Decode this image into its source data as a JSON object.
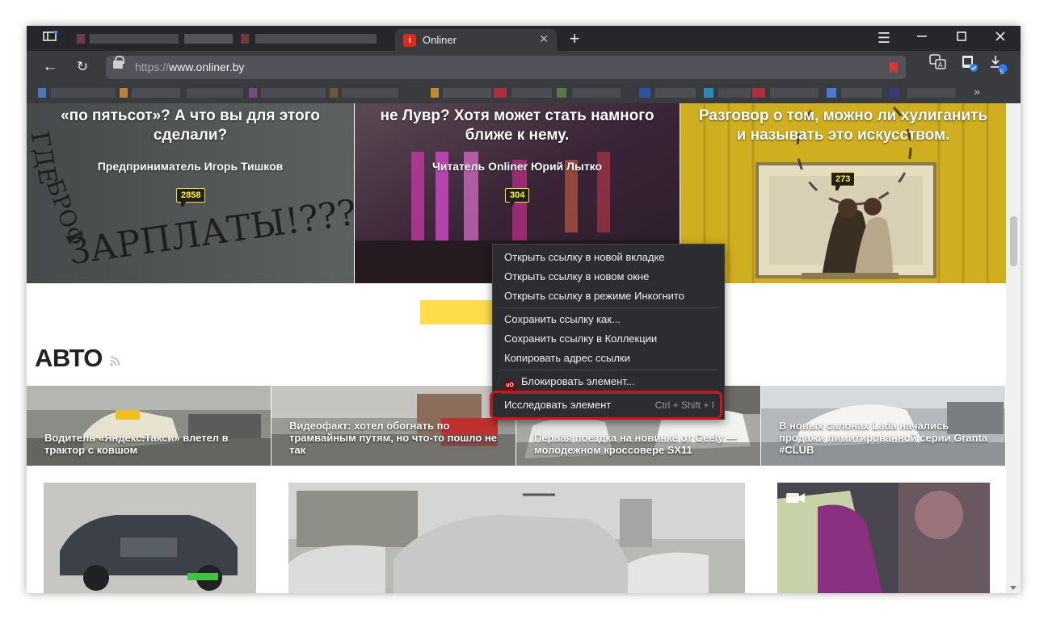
{
  "browser": {
    "tab_title": "Onliner",
    "tab_favicon": "i",
    "url_prefix": "https://",
    "url_domain": "www.onliner.by",
    "download_count": "5"
  },
  "hero": [
    {
      "title": "«по пятьсот»? А что вы для этого сделали?",
      "author": "Предприниматель Игорь Тишков",
      "comments": "2858"
    },
    {
      "title": "не Лувр? Хотя может стать намного ближе к нему.",
      "author": "Читатель Onliner Юрий Лытко",
      "comments": "304"
    },
    {
      "title": "Разговор о том, можно ли хулиганить и называть это искусством.",
      "author": "",
      "comments": "273"
    }
  ],
  "section": {
    "title": "АВТО"
  },
  "news": [
    {
      "title": "Водитель «Яндекс.Такси» влетел в трактор с ковшом"
    },
    {
      "title": "Видеофакт: хотел обогнать по трамвайным путям, но что-то пошло не так"
    },
    {
      "title": "Первая поездка на новинке от Geely — молодежном кроссовере SX11"
    },
    {
      "title": "В новых салонах Lada начались продажи лимитированной серии Granta #CLUB"
    }
  ],
  "context_menu": {
    "open_new_tab": "Открыть ссылку в новой вкладке",
    "open_new_window": "Открыть ссылку в новом окне",
    "open_incognito": "Открыть ссылку в режиме Инкогнито",
    "save_link_as": "Сохранить ссылку как...",
    "save_to_collections": "Сохранить ссылку в Коллекции",
    "copy_link": "Копировать адрес ссылки",
    "block_element": "Блокировать элемент...",
    "block_icon_text": "uO",
    "inspect": "Исследовать элемент",
    "inspect_shortcut": "Ctrl + Shift + I"
  },
  "colors": {
    "accent_yellow": "#fedd4d",
    "highlight_red": "#d0121b",
    "tab_bar": "#26272b",
    "toolbar": "#3a3b3f"
  }
}
